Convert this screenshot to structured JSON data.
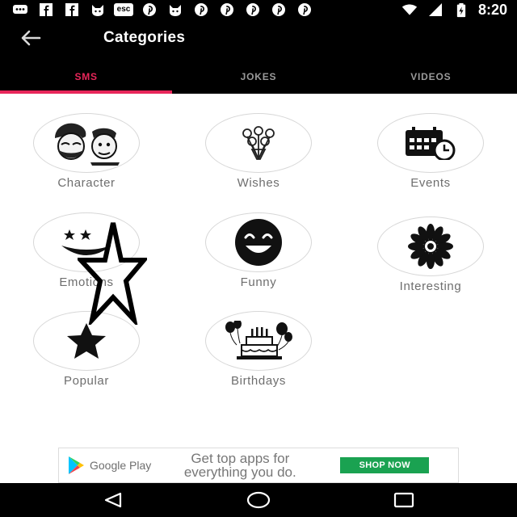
{
  "status_bar": {
    "time": "8:20",
    "left_icons": [
      "messages-icon",
      "facebook-icon",
      "facebook-icon",
      "cat-icon",
      "esc-icon",
      "pinterest-icon",
      "cat-icon",
      "pinterest-icon",
      "pinterest-icon",
      "pinterest-icon",
      "pinterest-icon",
      "pinterest-icon"
    ],
    "esc_label": "esc",
    "right_icons": [
      "wifi-icon",
      "signal-icon",
      "battery-charging-icon"
    ]
  },
  "app_bar": {
    "title": "Categories",
    "back_icon": "arrow-back-icon"
  },
  "tabs": [
    {
      "label": "SMS",
      "active": true
    },
    {
      "label": "JOKES",
      "active": false
    },
    {
      "label": "VIDEOS",
      "active": false
    }
  ],
  "categories": [
    {
      "label": "Character",
      "icon": "character-icon"
    },
    {
      "label": "Wishes",
      "icon": "flower-bouquet-icon"
    },
    {
      "label": "Events",
      "icon": "calendar-clock-icon"
    },
    {
      "label": "Emotions",
      "icon": "emotions-icon"
    },
    {
      "label": "Funny",
      "icon": "laughing-face-icon"
    },
    {
      "label": "Interesting",
      "icon": "sunflower-icon"
    },
    {
      "label": "Popular",
      "icon": "star-icon"
    },
    {
      "label": "Birthdays",
      "icon": "birthday-cake-icon"
    }
  ],
  "ad": {
    "store_name": "Google Play",
    "headline_line1": "Get top apps for",
    "headline_line2": "everything you do.",
    "cta": "SHOP NOW"
  },
  "colors": {
    "accent": "#e8265a",
    "tab_inactive": "#9a9a9a",
    "bar_background": "#000000",
    "label_gray": "#6e6e6e",
    "ad_button": "#1aa251"
  }
}
